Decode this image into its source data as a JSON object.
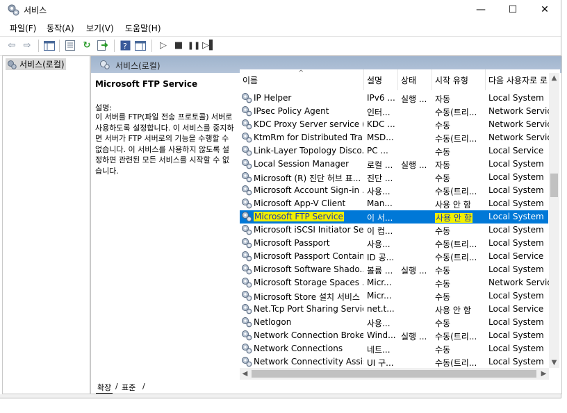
{
  "window": {
    "title": "서비스",
    "minimize": "—",
    "maximize": "☐",
    "close": "✕"
  },
  "menu": [
    "파일(F)",
    "동작(A)",
    "보기(V)",
    "도움말(H)"
  ],
  "toolbar": {
    "icons": [
      "back-icon",
      "forward-icon",
      "show-console-tree-icon",
      "properties-icon",
      "refresh-icon",
      "export-list-icon",
      "help-icon",
      "show-action-pane-icon",
      "start-icon",
      "stop-icon",
      "pause-icon",
      "restart-icon"
    ]
  },
  "tree": {
    "item": "서비스(로컬)"
  },
  "pane": {
    "header": "서비스(로컬)",
    "selected_title": "Microsoft FTP Service",
    "description_label": "설명:",
    "description": "이 서버를 FTP(파일 전송 프로토콜) 서버로 사용하도록 설정합니다. 이 서비스를 중지하면 서버가 FTP 서버로의 기능을 수행할 수 없습니다. 이 서비스를 사용하지 않도록 설정하면 관련된 모든 서비스를 시작할 수 없습니다."
  },
  "columns": [
    "이름",
    "설명",
    "상태",
    "시작 유형",
    "다음 사용자로 로"
  ],
  "rows": [
    {
      "name": "IP Helper",
      "desc": "IPv6 ...",
      "status": "실행 ...",
      "startup": "자동",
      "logon": "Local System"
    },
    {
      "name": "IPsec Policy Agent",
      "desc": "인터...",
      "status": "",
      "startup": "수동(트리...",
      "logon": "Network Service"
    },
    {
      "name": "KDC Proxy Server service (...",
      "desc": "KDC ...",
      "status": "",
      "startup": "수동",
      "logon": "Network Service"
    },
    {
      "name": "KtmRm for Distributed Tra...",
      "desc": "MSD...",
      "status": "",
      "startup": "수동(트리...",
      "logon": "Network Service"
    },
    {
      "name": "Link-Layer Topology Disco...",
      "desc": "PC ...",
      "status": "",
      "startup": "수동",
      "logon": "Local Service"
    },
    {
      "name": "Local Session Manager",
      "desc": "로컬 ...",
      "status": "실행 ...",
      "startup": "자동",
      "logon": "Local System"
    },
    {
      "name": "Microsoft (R) 진단 허브 표...",
      "desc": "진단 ...",
      "status": "",
      "startup": "수동",
      "logon": "Local System"
    },
    {
      "name": "Microsoft Account Sign-in ...",
      "desc": "사용...",
      "status": "",
      "startup": "수동(트리...",
      "logon": "Local System"
    },
    {
      "name": "Microsoft App-V Client",
      "desc": "Man...",
      "status": "",
      "startup": "사용 안 함",
      "logon": "Local System"
    },
    {
      "name": "Microsoft FTP Service",
      "desc": "이 서...",
      "status": "",
      "startup": "사용 안 함",
      "logon": "Local System",
      "selected": true
    },
    {
      "name": "Microsoft iSCSI Initiator Se...",
      "desc": "이 컴...",
      "status": "",
      "startup": "수동",
      "logon": "Local System"
    },
    {
      "name": "Microsoft Passport",
      "desc": "사용...",
      "status": "",
      "startup": "수동(트리...",
      "logon": "Local System"
    },
    {
      "name": "Microsoft Passport Container",
      "desc": "ID 공...",
      "status": "",
      "startup": "수동(트리...",
      "logon": "Local Service"
    },
    {
      "name": "Microsoft Software Shado...",
      "desc": "볼륨 ...",
      "status": "실행 ...",
      "startup": "수동",
      "logon": "Local System"
    },
    {
      "name": "Microsoft Storage Spaces ...",
      "desc": "Micr...",
      "status": "",
      "startup": "수동",
      "logon": "Network Service"
    },
    {
      "name": "Microsoft Store 설치 서비스",
      "desc": "Micr...",
      "status": "",
      "startup": "수동",
      "logon": "Local System"
    },
    {
      "name": "Net.Tcp Port Sharing Service",
      "desc": "net.t...",
      "status": "",
      "startup": "사용 안 함",
      "logon": "Local Service"
    },
    {
      "name": "Netlogon",
      "desc": "사용...",
      "status": "",
      "startup": "수동",
      "logon": "Local System"
    },
    {
      "name": "Network Connection Broker",
      "desc": "Wind...",
      "status": "실행 ...",
      "startup": "수동(트리...",
      "logon": "Local System"
    },
    {
      "name": "Network Connections",
      "desc": "네트...",
      "status": "",
      "startup": "수동",
      "logon": "Local System"
    },
    {
      "name": "Network Connectivity Assis...",
      "desc": "UI 구...",
      "status": "",
      "startup": "수동(트리...",
      "logon": "Local System"
    }
  ],
  "tabs": [
    "확장",
    "표준"
  ],
  "colors": {
    "selection": "#0078d7",
    "highlighter": "#f0f000",
    "pane_header": "#a9bbd2"
  }
}
